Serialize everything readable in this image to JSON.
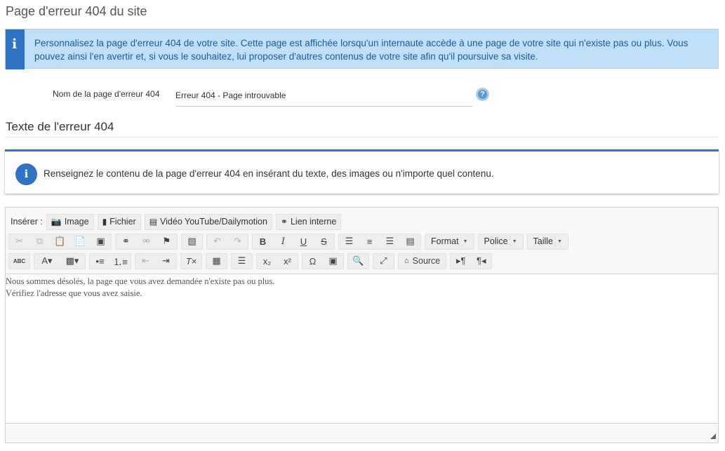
{
  "page": {
    "title": "Page d'erreur 404 du site"
  },
  "info_banner": {
    "icon": "info-icon",
    "text": "Personnalisez la page d'erreur 404 de votre site. Cette page est affichée lorsqu'un internaute accède à une page de votre site qui n'existe pas ou plus. Vous pouvez ainsi l'en avertir et, si vous le souhaitez, lui proposer d'autres contenus de votre site afin qu'il poursuive sa visite."
  },
  "name_field": {
    "label": "Nom de la page d'erreur 404",
    "value": "Erreur 404 - Page introuvable",
    "help_icon": "question-circle-icon"
  },
  "section": {
    "title": "Texte de l'erreur 404"
  },
  "notice": {
    "icon": "info-icon",
    "text": "Renseignez le contenu de la page d'erreur 404 en insérant du texte, des images ou n'importe quel contenu."
  },
  "editor": {
    "insert_label": "Insérer :",
    "insert_buttons": [
      {
        "label": "Image",
        "icon": "camera-icon"
      },
      {
        "label": "Fichier",
        "icon": "file-icon"
      },
      {
        "label": "Vidéo YouTube/Dailymotion",
        "icon": "film-icon"
      },
      {
        "label": "Lien interne",
        "icon": "link-icon"
      }
    ],
    "combos": {
      "format": "Format",
      "font": "Police",
      "size": "Taille"
    },
    "source_label": "Source",
    "content": [
      "Nous sommes désolés, la page que vous avez demandée n'existe pas ou plus.",
      "Vérifiez l'adresse que vous avez saisie."
    ]
  }
}
